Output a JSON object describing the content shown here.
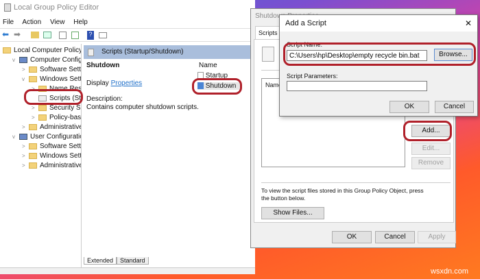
{
  "main": {
    "title": "Local Group Policy Editor",
    "menu": [
      "File",
      "Action",
      "View",
      "Help"
    ],
    "tree": [
      {
        "label": "Local Computer Policy",
        "level": 0
      },
      {
        "label": "Computer Configurat",
        "level": 1,
        "chev": "v"
      },
      {
        "label": "Software Settings",
        "level": 2,
        "chev": ">"
      },
      {
        "label": "Windows Settings",
        "level": 2,
        "chev": "v"
      },
      {
        "label": "Name Resolut",
        "level": 3,
        "chev": ">"
      },
      {
        "label": "Scripts (Startu",
        "level": 3
      },
      {
        "label": "Security Settir",
        "level": 3,
        "chev": ">"
      },
      {
        "label": "Policy-based (",
        "level": 3,
        "chev": ">"
      },
      {
        "label": "Administrative Te",
        "level": 2,
        "chev": ">"
      },
      {
        "label": "User Configuration",
        "level": 1,
        "chev": "v"
      },
      {
        "label": "Software Settings",
        "level": 2,
        "chev": ">"
      },
      {
        "label": "Windows Settings",
        "level": 2,
        "chev": ">"
      },
      {
        "label": "Administrative Te",
        "level": 2,
        "chev": ">"
      }
    ],
    "panel_header": "Scripts (Startup/Shutdown)",
    "heading": "Shutdown",
    "display": "Display",
    "properties_link": "Properties",
    "desc_label": "Description:",
    "desc_text": "Contains computer shutdown scripts.",
    "list_header": "Name",
    "list_items": [
      "Startup",
      "Shutdown"
    ],
    "tabs": [
      "Extended",
      "Standard"
    ]
  },
  "props": {
    "title": "Shutdown Properties",
    "tab": "Scripts",
    "list_header": "Name",
    "add": "Add...",
    "edit": "Edit...",
    "remove": "Remove",
    "info": "To view the script files stored in this Group Policy Object, press the button below.",
    "show_files": "Show Files...",
    "ok": "OK",
    "cancel": "Cancel",
    "apply": "Apply"
  },
  "add_script": {
    "title": "Add a Script",
    "close": "✕",
    "name_label": "Script Name:",
    "name_value": "C:\\Users\\hp\\Desktop\\empty recycle bin.bat",
    "browse": "Browse...",
    "params_label": "Script Parameters:",
    "params_value": "",
    "ok": "OK",
    "cancel": "Cancel"
  },
  "watermark": "wsxdn.com"
}
